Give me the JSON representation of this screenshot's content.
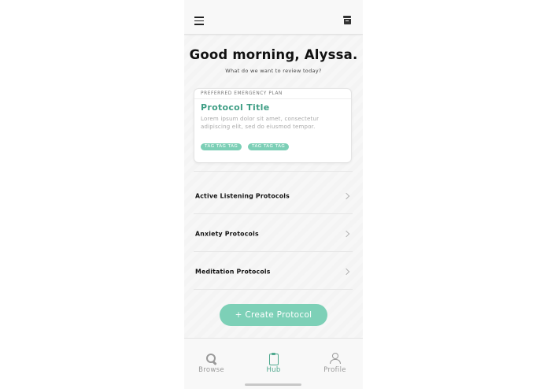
{
  "header": {
    "menu_icon": "hamburger-menu-icon",
    "archive_icon": "archive-box-icon"
  },
  "greeting": {
    "title": "Good morning, Alyssa.",
    "subtitle": "What do we want to review today?"
  },
  "featured_card": {
    "eyebrow": "PREFERRED EMERGENCY PLAN",
    "title": "Protocol Title",
    "body": "Lorem ipsum dolor sit amet, consectetur adipiscing elit, sed do eiusmod tempor.",
    "tags": [
      "TAG TAG TAG",
      "TAG TAG TAG"
    ]
  },
  "protocol_list": [
    {
      "label": "Active Listening Protocols"
    },
    {
      "label": "Anxiety Protocols"
    },
    {
      "label": "Meditation Protocols"
    }
  ],
  "create_button": {
    "label": "+ Create Protocol"
  },
  "bottom_nav": {
    "items": [
      {
        "label": "Browse",
        "icon": "search-icon",
        "active": false
      },
      {
        "label": "Hub",
        "icon": "clipboard-icon",
        "active": true
      },
      {
        "label": "Profile",
        "icon": "person-icon",
        "active": false
      }
    ]
  },
  "colors": {
    "accent": "#7dd0b7",
    "accent_text": "#3f9e85",
    "inactive": "#9a9a9a"
  }
}
